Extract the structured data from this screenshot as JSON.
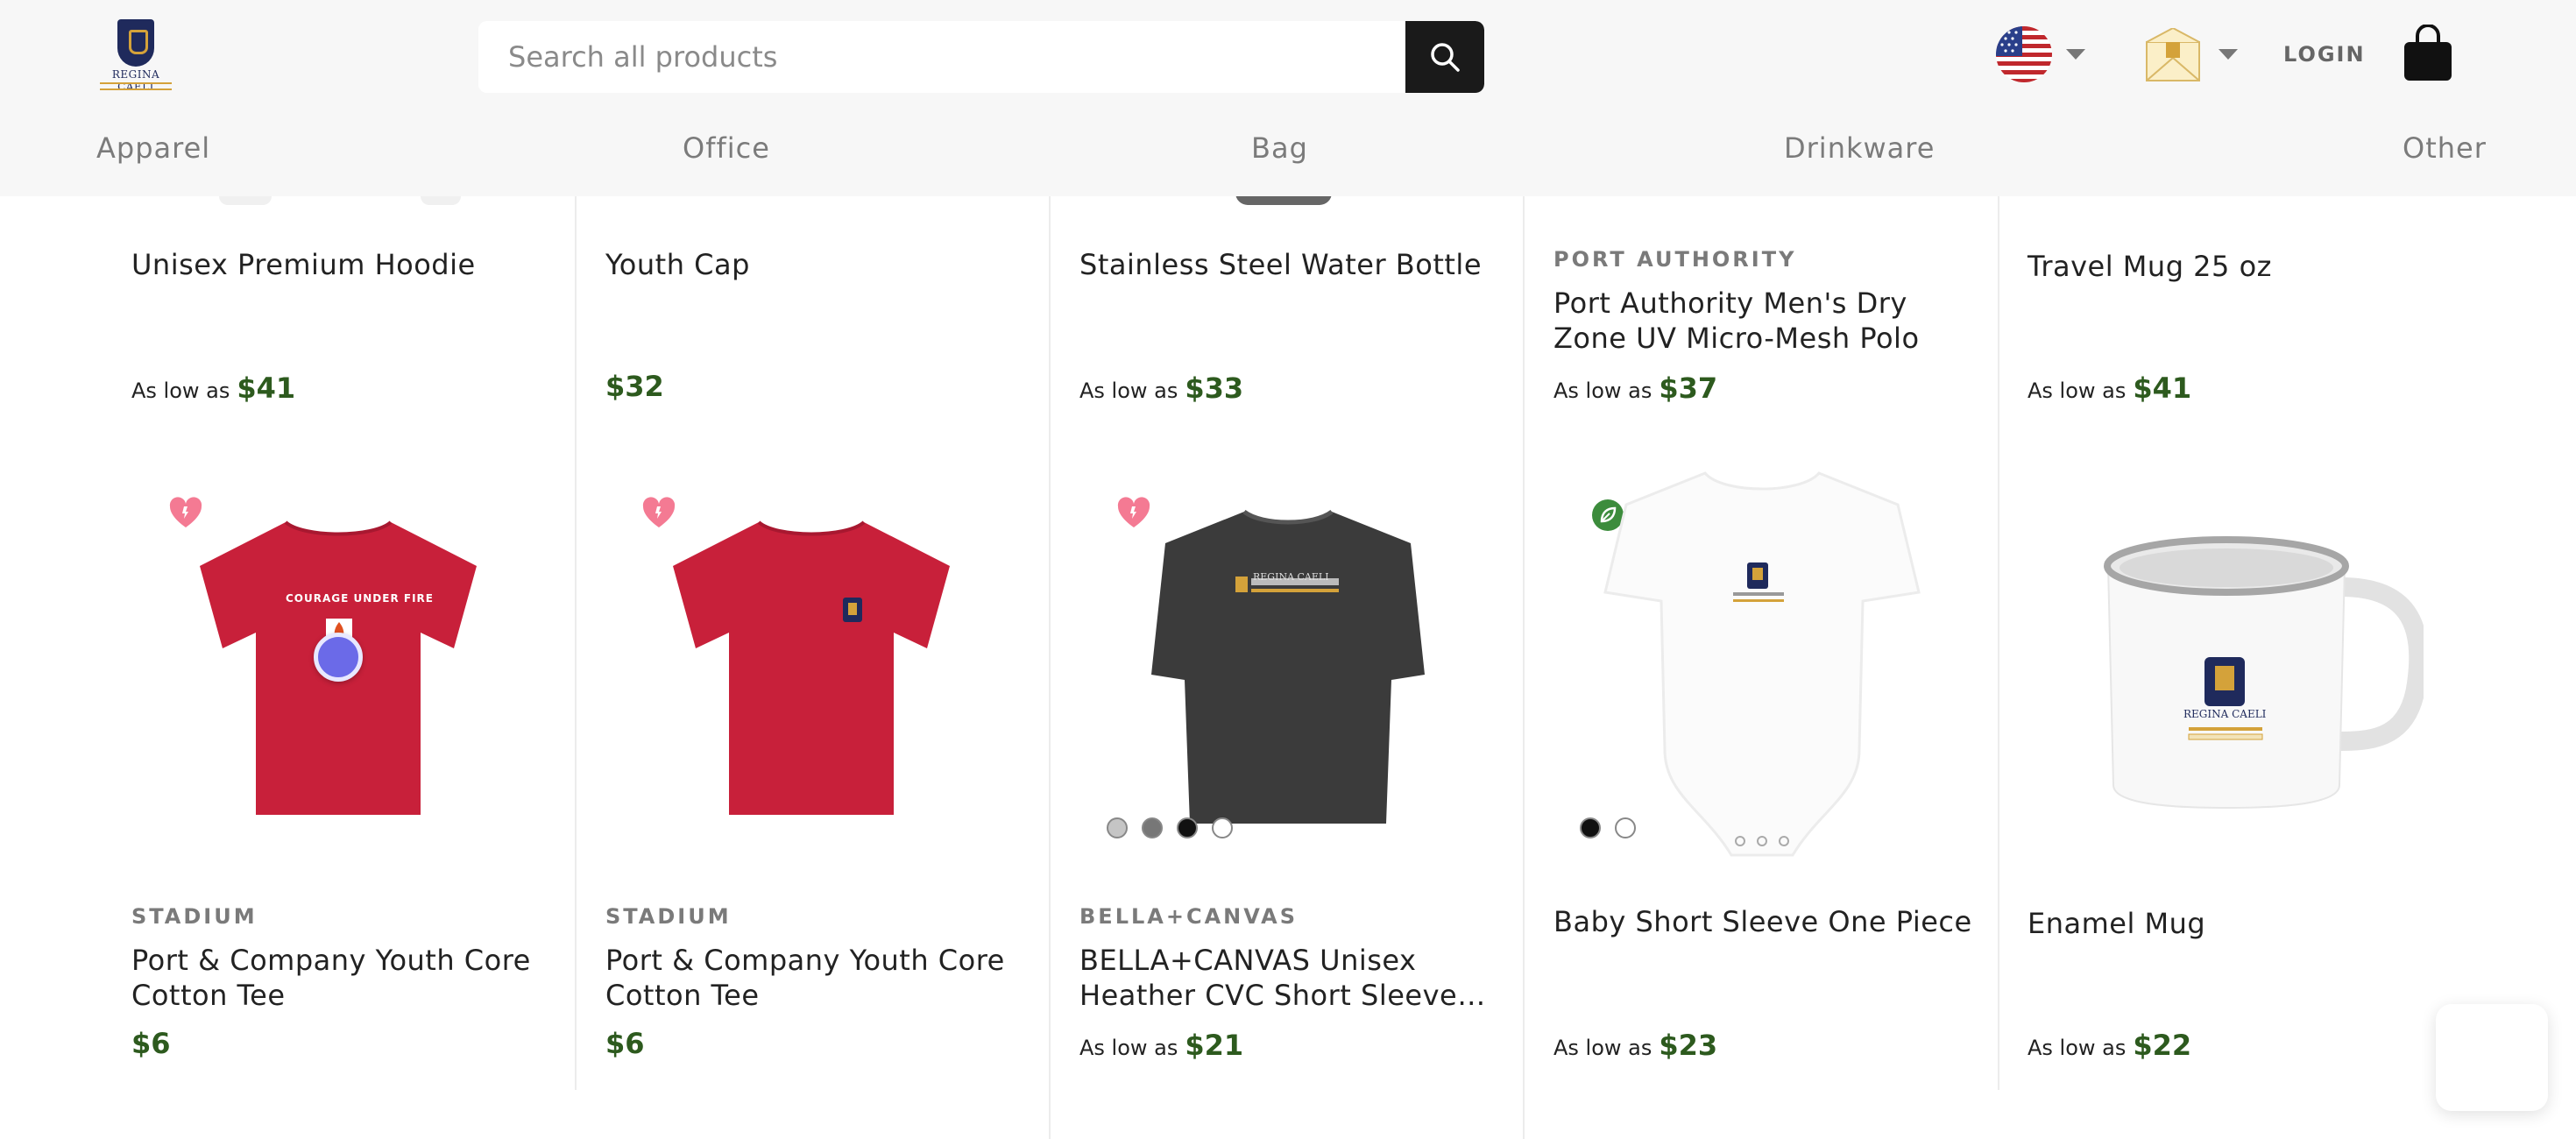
{
  "header": {
    "logo_text": "REGINA CAELI",
    "search_placeholder": "Search all products",
    "login_label": "LOGIN"
  },
  "nav": [
    "Apparel",
    "Office",
    "Bag",
    "Drinkware",
    "Other"
  ],
  "row1": [
    {
      "title": "Unisex Premium Hoodie",
      "brand": "",
      "price_label": "As low as",
      "price": "$41"
    },
    {
      "title": "Youth Cap",
      "brand": "",
      "price_label": "",
      "price": "$32"
    },
    {
      "title": "Stainless Steel Water Bottle",
      "brand": "",
      "price_label": "As low as",
      "price": "$33"
    },
    {
      "title_line1": "Port Authority Men's Dry",
      "title_line2": "Zone UV Micro-Mesh Polo",
      "brand": "PORT AUTHORITY",
      "price_label": "As low as",
      "price": "$37"
    },
    {
      "title": "Travel Mug 25 oz",
      "brand": "",
      "price_label": "As low as",
      "price": "$41"
    }
  ],
  "row2": [
    {
      "title_line1": "Port & Company Youth Core",
      "title_line2": "Cotton Tee",
      "brand": "STADIUM",
      "price": "$6",
      "shirt_text": "COURAGE UNDER FIRE"
    },
    {
      "title_line1": "Port & Company Youth Core",
      "title_line2": "Cotton Tee",
      "brand": "STADIUM",
      "price": "$6"
    },
    {
      "title_line1": "BELLA+CANVAS Unisex",
      "title_line2": "Heather CVC Short Sleeve…",
      "brand": "BELLA+CANVAS",
      "price_label": "As low as",
      "price": "$21",
      "shirt_text": "REGINA CAELI"
    },
    {
      "title": "Baby Short Sleeve One Piece",
      "price_label": "As low as",
      "price": "$23"
    },
    {
      "title": "Enamel Mug",
      "price_label": "As low as",
      "price": "$22",
      "mug_text": "REGINA CAELI"
    }
  ],
  "colors": {
    "price_green": "#2d5a1e",
    "tee_red": "#c8203a",
    "heart_pink": "#f47a93",
    "eco_green": "#3c8c3c",
    "navy": "#1f2a5c",
    "gold": "#d4a23a"
  },
  "icons": [
    "search-icon",
    "us-flag-icon",
    "envelope-icon",
    "shopping-bag-icon",
    "heart-badge-icon",
    "leaf-badge-icon",
    "chevron-down-icon"
  ]
}
